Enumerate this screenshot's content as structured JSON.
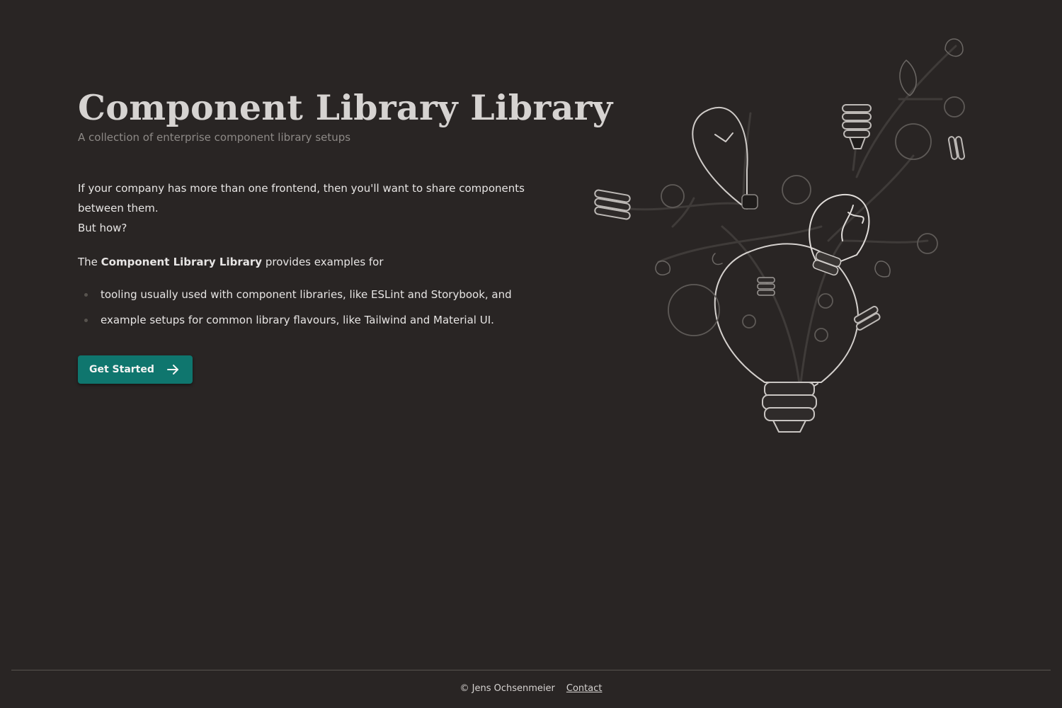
{
  "hero": {
    "title": "Component Library Library",
    "subtitle": "A collection of enterprise component library setups"
  },
  "intro": {
    "line1": "If your company has more than one frontend, then you'll want to share components between them.",
    "line2": "But how?"
  },
  "lead": {
    "prefix": "The ",
    "brand": "Component Library Library",
    "suffix": " provides examples for"
  },
  "features": [
    "tooling usually used with component libraries, like ESLint and Storybook, and",
    "example setups for common library flavours, like Tailwind and Material UI."
  ],
  "cta": {
    "label": "Get Started",
    "icon": "arrow-right-icon",
    "color": "#0f766e"
  },
  "illustration": {
    "icon": "lightbulb-sketch-illustration"
  },
  "footer": {
    "copyright": "© Jens Ochsenmeier",
    "contact": "Contact"
  },
  "colors": {
    "background": "#292524",
    "accent": "#0f766e",
    "heading": "#d6d3d1",
    "muted": "#8d8986"
  }
}
